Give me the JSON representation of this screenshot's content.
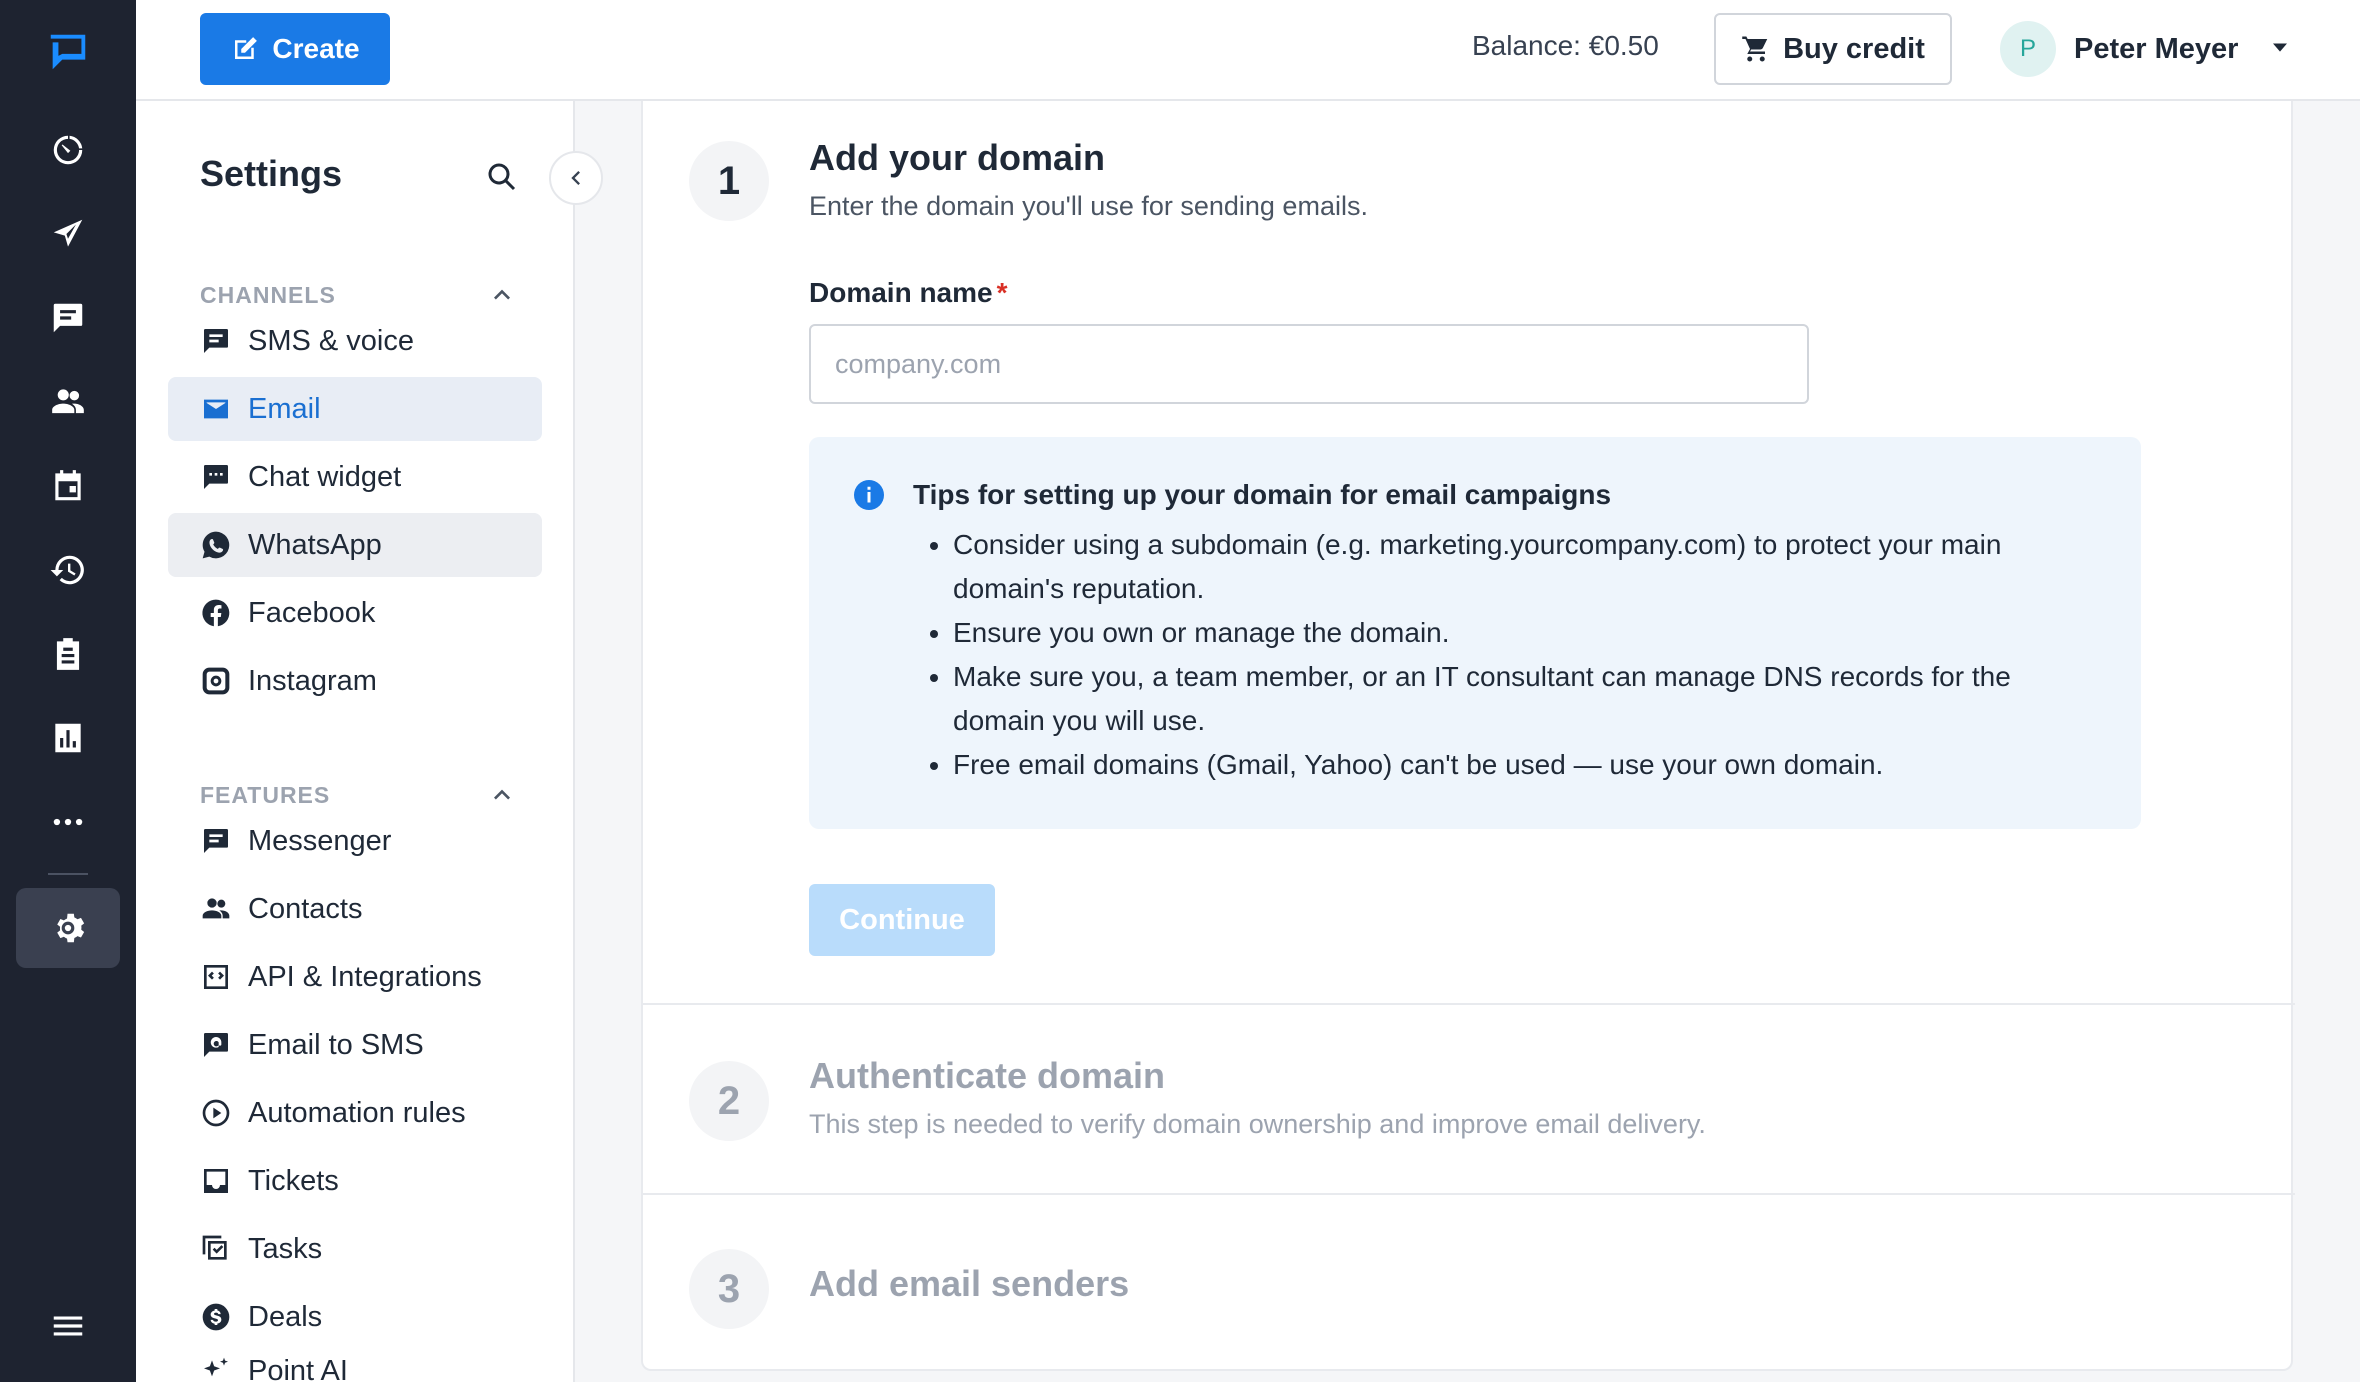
{
  "rail": {
    "items": [
      {
        "icon": "logo-icon"
      },
      {
        "icon": "dashboard-icon"
      },
      {
        "icon": "send-icon"
      },
      {
        "icon": "chat-icon"
      },
      {
        "icon": "contacts-icon"
      },
      {
        "icon": "calendar-icon"
      },
      {
        "icon": "history-icon"
      },
      {
        "icon": "clipboard-icon"
      },
      {
        "icon": "analytics-icon"
      },
      {
        "icon": "more-icon"
      },
      {
        "icon": "settings-icon",
        "active": true
      },
      {
        "icon": "menu-icon"
      }
    ]
  },
  "topbar": {
    "create_label": "Create",
    "balance": "Balance: €0.50",
    "buy_credit_label": "Buy credit",
    "user_initial": "P",
    "user_name": "Peter Meyer"
  },
  "settings": {
    "title": "Settings",
    "channels_heading": "CHANNELS",
    "channels": [
      {
        "label": "SMS & voice",
        "icon": "sms-icon"
      },
      {
        "label": "Email",
        "icon": "email-icon",
        "selected": true
      },
      {
        "label": "Chat widget",
        "icon": "chat-widget-icon"
      },
      {
        "label": "WhatsApp",
        "icon": "whatsapp-icon"
      },
      {
        "label": "Facebook",
        "icon": "facebook-icon"
      },
      {
        "label": "Instagram",
        "icon": "instagram-icon"
      }
    ],
    "features_heading": "FEATURES",
    "features": [
      {
        "label": "Messenger",
        "icon": "messenger-icon"
      },
      {
        "label": "Contacts",
        "icon": "contacts-icon"
      },
      {
        "label": "API & Integrations",
        "icon": "api-icon"
      },
      {
        "label": "Email to SMS",
        "icon": "email-to-sms-icon"
      },
      {
        "label": "Automation rules",
        "icon": "automation-icon"
      },
      {
        "label": "Tickets",
        "icon": "tickets-icon"
      },
      {
        "label": "Tasks",
        "icon": "tasks-icon"
      },
      {
        "label": "Deals",
        "icon": "deals-icon"
      },
      {
        "label": "Point AI",
        "icon": "ai-icon"
      }
    ]
  },
  "steps": [
    {
      "number": "1",
      "title": "Add your domain",
      "subtitle": "Enter the domain you'll use for sending emails."
    },
    {
      "number": "2",
      "title": "Authenticate domain",
      "subtitle": "This step is needed to verify domain ownership and improve email delivery."
    },
    {
      "number": "3",
      "title": "Add email senders"
    }
  ],
  "domain_field": {
    "label": "Domain name",
    "required_mark": "*",
    "placeholder": "company.com",
    "value": ""
  },
  "tips": {
    "title": "Tips for setting up your domain for email campaigns",
    "items": [
      "Consider using a subdomain (e.g. marketing.yourcompany.com) to protect your main domain's reputation.",
      "Ensure you own or manage the domain.",
      "Make sure you, a team member, or an IT consultant can manage DNS records for the domain you will use.",
      "Free email domains (Gmail, Yahoo) can't be used — use your own domain."
    ]
  },
  "continue_label": "Continue",
  "colors": {
    "rail_bg": "#1e2330",
    "primary": "#1a7ae6",
    "selected_text": "#1a6fd1",
    "tips_bg": "#eef5fc",
    "continue_disabled": "#b9dcfb"
  }
}
